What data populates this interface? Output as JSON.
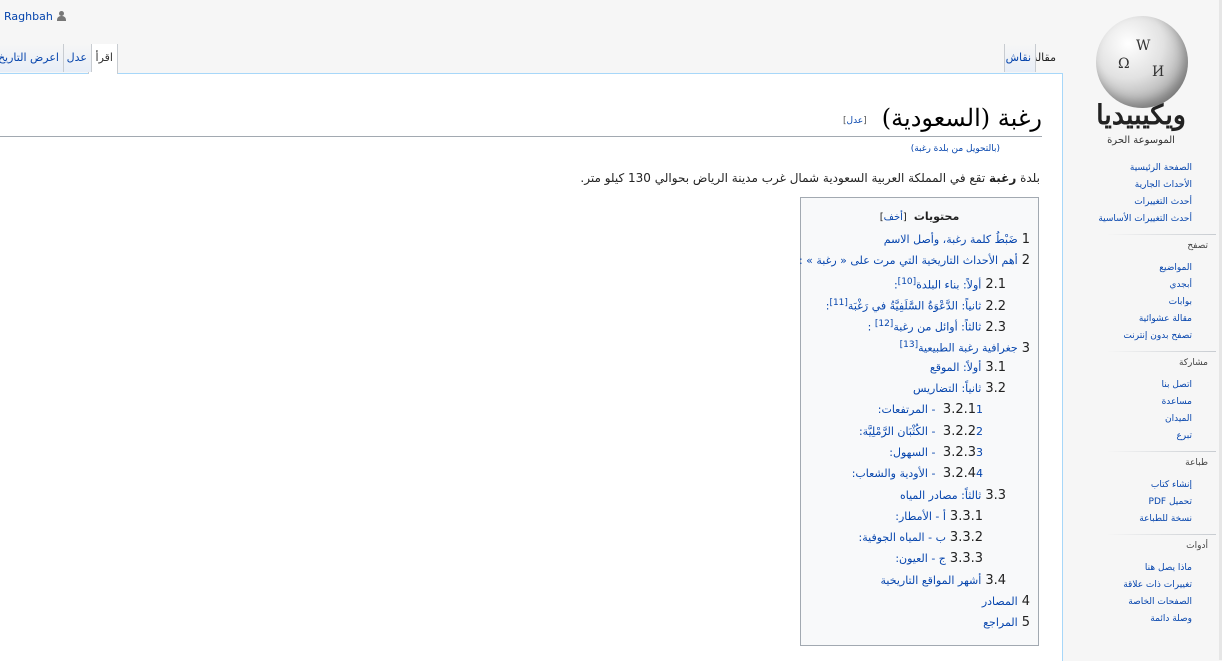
{
  "user": {
    "name": "Raghbah"
  },
  "logo": {
    "wordmark": "ويكيبيديا",
    "tagline": "الموسوعة الحرة"
  },
  "tabs": {
    "article": "مقالة",
    "talk": "نقاش",
    "read": "اقرأ",
    "edit": "عدل",
    "history": "اعرض التاريخ"
  },
  "page": {
    "title": "رغبة (السعودية)",
    "edit_label": "عدل",
    "redirect_text": "(بالتحويل من بلدة رغبة)",
    "intro_bold": "رغبة",
    "intro_prefix": "بلدة ",
    "intro_rest": " تقع في المملكة العربية السعودية شمال غرب مدينة الرياض بحوالي 130 كيلو متر."
  },
  "toc": {
    "title": "محتويات",
    "toggle": "أخف",
    "items": [
      {
        "num": "1",
        "text": "ضَبْطُ كلمة رغبة، وأصل الاسم",
        "level": 1
      },
      {
        "num": "2",
        "text": "أهم الأحداث التاريخية التي مرت على « رغبة » :",
        "level": 1
      },
      {
        "num": "2.1",
        "text": "أولاً: بناء البلدة",
        "sup": "[10]",
        "after": ":",
        "level": 2
      },
      {
        "num": "2.2",
        "text": "ثانياً: الدَّعْوَةُ السَّلَفِيَّةُ في رَغْبَة",
        "sup": "[11]",
        "after": ":",
        "level": 2
      },
      {
        "num": "2.3",
        "text": "ثالثاً: أوائل من رغبة",
        "sup": "[12]",
        "after": " :",
        "level": 2
      },
      {
        "num": "3",
        "text": "جغرافية رغبة الطبيعية",
        "sup": "[13]",
        "after": "",
        "level": 1
      },
      {
        "num": "3.1",
        "text": "أولاً: الموقع",
        "level": 2
      },
      {
        "num": "3.2",
        "text": "ثانياً: التضاريس",
        "level": 2
      },
      {
        "num": "3.2.1",
        "text": "1 - المرتفعات:",
        "level": 3
      },
      {
        "num": "3.2.2",
        "text": "2 - الكُثْبَان الرَّمْلِيَّة:",
        "level": 3
      },
      {
        "num": "3.2.3",
        "text": "3 - السهول:",
        "level": 3
      },
      {
        "num": "3.2.4",
        "text": "4 - الأودية والشعاب:",
        "level": 3
      },
      {
        "num": "3.3",
        "text": "ثالثاً: مصادر المياه",
        "level": 2
      },
      {
        "num": "3.3.1",
        "text": "أ - الأمطار:",
        "level": 3
      },
      {
        "num": "3.3.2",
        "text": "ب - المياه الجوفية:",
        "level": 3
      },
      {
        "num": "3.3.3",
        "text": "ج - العيون:",
        "level": 3
      },
      {
        "num": "3.4",
        "text": "أشهر المواقع التاريخية",
        "level": 2
      },
      {
        "num": "4",
        "text": "المصادر",
        "level": 1
      },
      {
        "num": "5",
        "text": "المراجع",
        "level": 1
      }
    ]
  },
  "sidebar": {
    "main": [
      "الصفحة الرئيسية",
      "الأحداث الجارية",
      "أحدث التغييرات",
      "أحدث التغييرات الأساسية"
    ],
    "browse": {
      "head": "تصفح",
      "items": [
        "المواضيع",
        "أبجدي",
        "بوابات",
        "مقالة عشوائية",
        "تصفح بدون إنترنت"
      ]
    },
    "participate": {
      "head": "مشاركة",
      "items": [
        "اتصل بنا",
        "مساعدة",
        "الميدان",
        "تبرع"
      ]
    },
    "print": {
      "head": "طباعة",
      "items": [
        "إنشاء كتاب",
        "تحميل PDF",
        "نسخة للطباعة"
      ]
    },
    "tools": {
      "head": "أدوات",
      "items": [
        "ماذا يصل هنا",
        "تغييرات ذات علاقة",
        "الصفحات الخاصة",
        "وصلة دائمة"
      ]
    }
  }
}
